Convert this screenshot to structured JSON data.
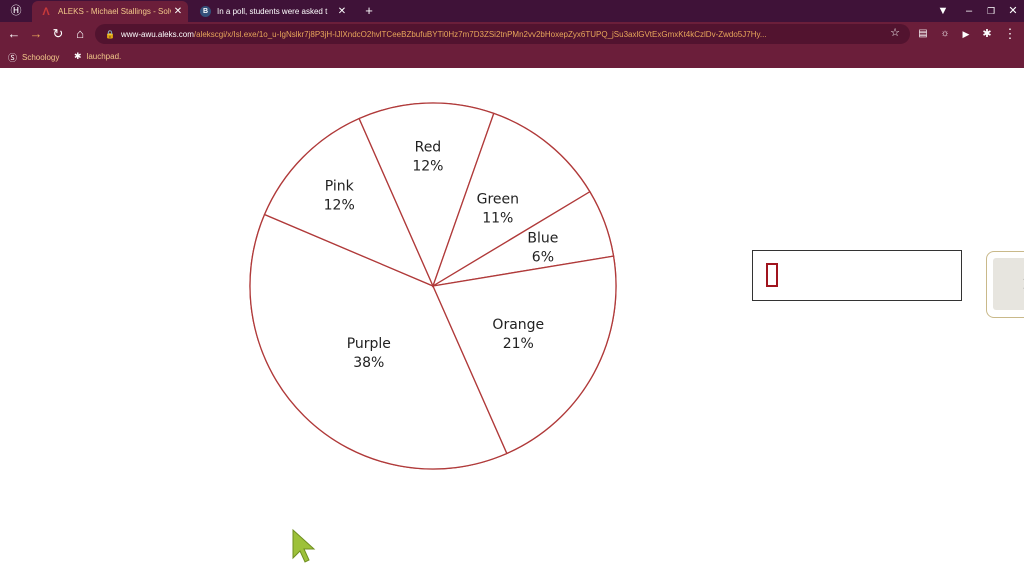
{
  "browser": {
    "tabs": [
      {
        "title": "ALEKS - Michael Stallings - Solv",
        "favicon": "aleks-icon",
        "active": true
      },
      {
        "title": "In a poll, students were asked t",
        "favicon": "brainly-icon",
        "active": false
      }
    ],
    "new_tab_symbol": "+",
    "url_host": "www-awu.aleks.com",
    "url_path": "/alekscgi/x/Isl.exe/1o_u-IgNslkr7j8P3jH-lJlXndcO2hvlTCeeBZbufuBYTi0Hz7m7D3ZSi2tnPMn2vv2bHoxepZyx6TUPQ_jSu3axlGVtExGmxKt4kCzlDv-Zwdo5J7Hy...",
    "bookmarks": [
      {
        "label": "Schoology",
        "icon": "schoology-icon"
      },
      {
        "label": "lauchpad.",
        "icon": "launchpad-icon"
      }
    ]
  },
  "chart_data": {
    "type": "pie",
    "slices": [
      {
        "label": "Purple",
        "percent_label": "38%",
        "value": 38
      },
      {
        "label": "Pink",
        "percent_label": "12%",
        "value": 12
      },
      {
        "label": "Red",
        "percent_label": "12%",
        "value": 12
      },
      {
        "label": "Green",
        "percent_label": "11%",
        "value": 11
      },
      {
        "label": "Blue",
        "percent_label": "6%",
        "value": 6
      },
      {
        "label": "Orange",
        "percent_label": "21%",
        "value": 21
      }
    ],
    "colors": {
      "stroke": "#b03a3a",
      "fill": "#ffffff"
    }
  },
  "answer_input": {
    "value": ""
  },
  "colors": {
    "chrome": "#6b1e3a",
    "tabstrip": "#3f1238",
    "url_path": "#e8a65b"
  }
}
